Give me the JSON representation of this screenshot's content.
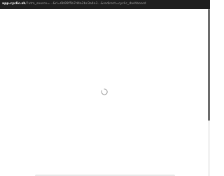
{
  "browser": {
    "url_host": "app.cyclic.sh",
    "url_path": "/?utm_source=...&rl=6b99f5b7d4a2bc3a4e3...&redirect=cyclic_dashboard"
  },
  "page": {
    "state": "loading",
    "spinner_icon": "loading-spinner-icon"
  },
  "colors": {
    "url_bar_bg": "#1f1f1f",
    "url_host": "#ffffff",
    "url_path": "#a0a0a0",
    "page_bg": "#ffffff",
    "spinner": "#9e9e9e",
    "scrollbar_thumb": "#6b6b6b"
  }
}
